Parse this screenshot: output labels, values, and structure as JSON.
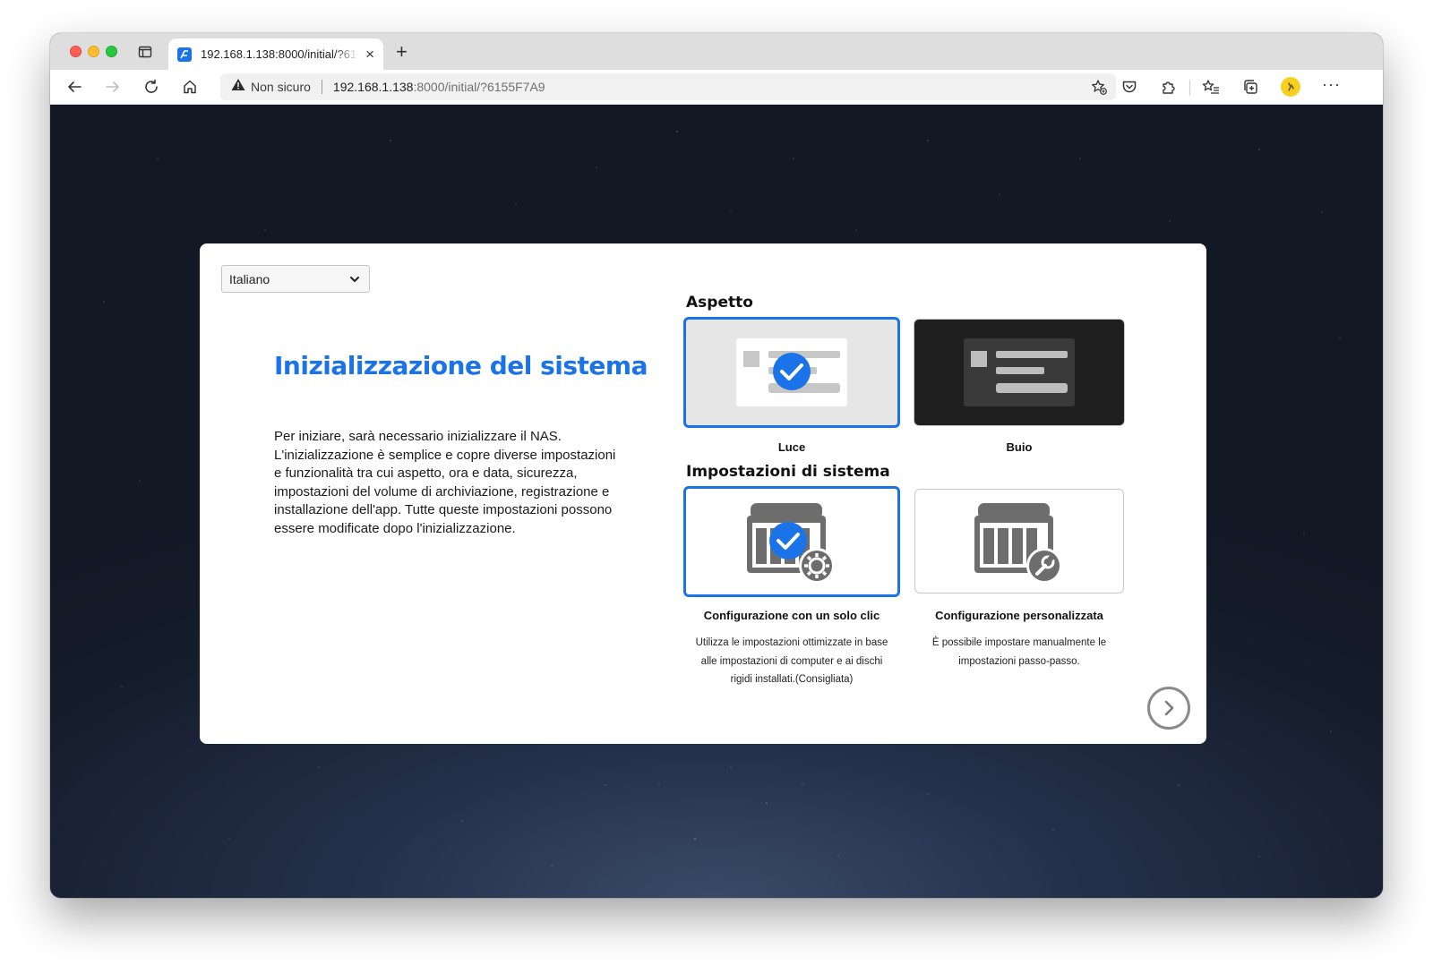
{
  "browser": {
    "tab": {
      "title": "192.168.1.138:8000/initial/?6155F7A9",
      "close_glyph": "×"
    },
    "new_tab_glyph": "+",
    "address": {
      "security_label": "Non sicuro",
      "host": "192.168.1.138",
      "path": ":8000/initial/?6155F7A9"
    },
    "more_glyph": "···"
  },
  "setup": {
    "language": {
      "selected": "Italiano"
    },
    "title": "Inizializzazione del sistema",
    "description": "Per iniziare, sarà necessario inizializzare il NAS. L'inizializzazione è semplice e copre diverse impostazioni e funzionalità tra cui aspetto, ora e data, sicurezza, impostazioni del volume di archiviazione, registrazione e installazione dell'app. Tutte queste impostazioni possono essere modificate dopo l'inizializzazione.",
    "appearance": {
      "heading": "Aspetto",
      "options": [
        {
          "label": "Luce",
          "selected": true
        },
        {
          "label": "Buio",
          "selected": false
        }
      ]
    },
    "system_settings": {
      "heading": "Impostazioni di sistema",
      "options": [
        {
          "label": "Configurazione con un solo clic",
          "description": "Utilizza le impostazioni ottimizzate in base alle impostazioni di computer e ai dischi rigidi installati.(Consigliata)",
          "selected": true
        },
        {
          "label": "Configurazione personalizzata",
          "description": "È possibile impostare manualmente le impostazioni passo-passo.",
          "selected": false
        }
      ]
    }
  },
  "colors": {
    "accent": "#1a73e8",
    "selected_border": "#1a73e8",
    "dark_theme_bg": "#1f1f1f",
    "light_theme_bg": "#e6e6e6"
  },
  "icons": {
    "back": "arrow-left-icon",
    "forward": "arrow-right-icon",
    "reload": "reload-icon",
    "home": "home-icon",
    "warning": "warning-icon",
    "favorite_add": "star-add-icon",
    "pocket": "pocket-icon",
    "extensions": "puzzle-icon",
    "favorites": "favorites-icon",
    "collections": "collections-icon",
    "next": "chevron-right-circle-icon"
  }
}
